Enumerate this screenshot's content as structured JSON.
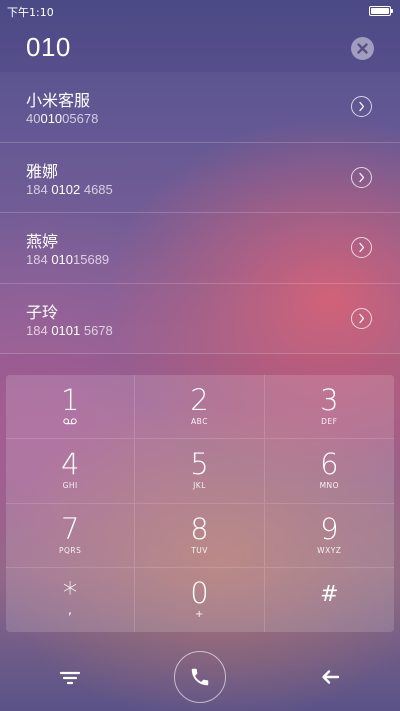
{
  "status_bar": {
    "time": "下午1:10",
    "battery_level": 1.0
  },
  "dialer": {
    "number": "010"
  },
  "contacts": [
    {
      "name": "小米客服",
      "number_before": "40",
      "number_match": "010",
      "number_after": "05678"
    },
    {
      "name": "雅娜",
      "number_before": "184 ",
      "number_match": "0102",
      "number_after": " 4685"
    },
    {
      "name": "燕婷",
      "number_before": "184 ",
      "number_match": "010",
      "number_after": "15689"
    },
    {
      "name": "子玲",
      "number_before": "184 ",
      "number_match": "0101",
      "number_after": " 5678"
    }
  ],
  "keypad": {
    "keys": [
      {
        "digit": "1",
        "letters": ""
      },
      {
        "digit": "2",
        "letters": "ABC"
      },
      {
        "digit": "3",
        "letters": "DEF"
      },
      {
        "digit": "4",
        "letters": "GHI"
      },
      {
        "digit": "5",
        "letters": "JKL"
      },
      {
        "digit": "6",
        "letters": "MNO"
      },
      {
        "digit": "7",
        "letters": "PQRS"
      },
      {
        "digit": "8",
        "letters": "TUV"
      },
      {
        "digit": "9",
        "letters": "WXYZ"
      },
      {
        "digit": "*",
        "letters": ","
      },
      {
        "digit": "0",
        "letters": "+"
      },
      {
        "digit": "#",
        "letters": ""
      }
    ]
  },
  "icons": {
    "clear": "close-icon",
    "detail": "chevron-right-icon",
    "voicemail": "voicemail-icon",
    "menu": "menu-icon",
    "call": "phone-icon",
    "back": "backspace-arrow-icon"
  },
  "colors": {
    "text": "#ffffff",
    "match_highlight": "#ffffff",
    "subtext": "#c9b8d6"
  }
}
